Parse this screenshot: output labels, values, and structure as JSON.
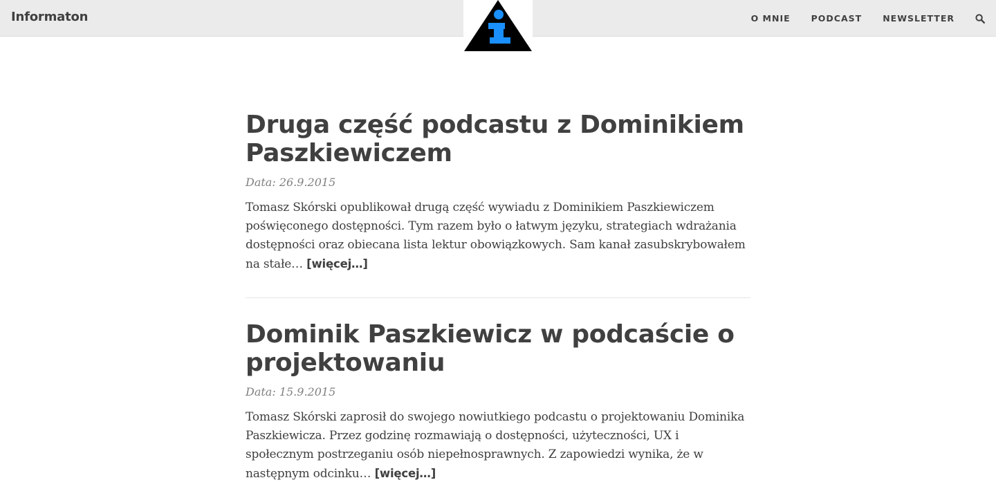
{
  "brand": {
    "name": "Informaton"
  },
  "nav": {
    "items": [
      {
        "label": "O MNIE"
      },
      {
        "label": "PODCAST"
      },
      {
        "label": "NEWSLETTER"
      }
    ]
  },
  "colors": {
    "navbar_bg": "#ebebeb",
    "text": "#404040",
    "meta": "#808080",
    "logo_triangle": "#000000",
    "logo_glyph": "#1a8fff"
  },
  "icons": {
    "logo": "info-triangle-icon",
    "search": "search-icon"
  },
  "posts": [
    {
      "title": "Druga część podcastu z Dominikiem Paszkiewiczem",
      "meta": "Data: 26.9.2015",
      "excerpt": "Tomasz Skórski opublikował drugą część wywiadu z Dominikiem Paszkiewiczem poświęconego dostępności. Tym razem było o łatwym języku, strategiach wdrażania dostępności oraz obiecana lista lektur obowiązkowych. Sam kanał zasubskrybowałem na stałe…",
      "read_more": "[więcej…]"
    },
    {
      "title": "Dominik Paszkiewicz w podcaście o projektowaniu",
      "meta": "Data: 15.9.2015",
      "excerpt": "Tomasz Skórski zaprosił do swojego nowiutkiego podcastu o projektowaniu Dominika Paszkiewicza. Przez godzinę rozmawiają o dostępności, użyteczności, UX i społecznym postrzeganiu osób niepełnosprawnych. Z zapowiedzi wynika, że w następnym odcinku…",
      "read_more": "[więcej…]"
    }
  ]
}
